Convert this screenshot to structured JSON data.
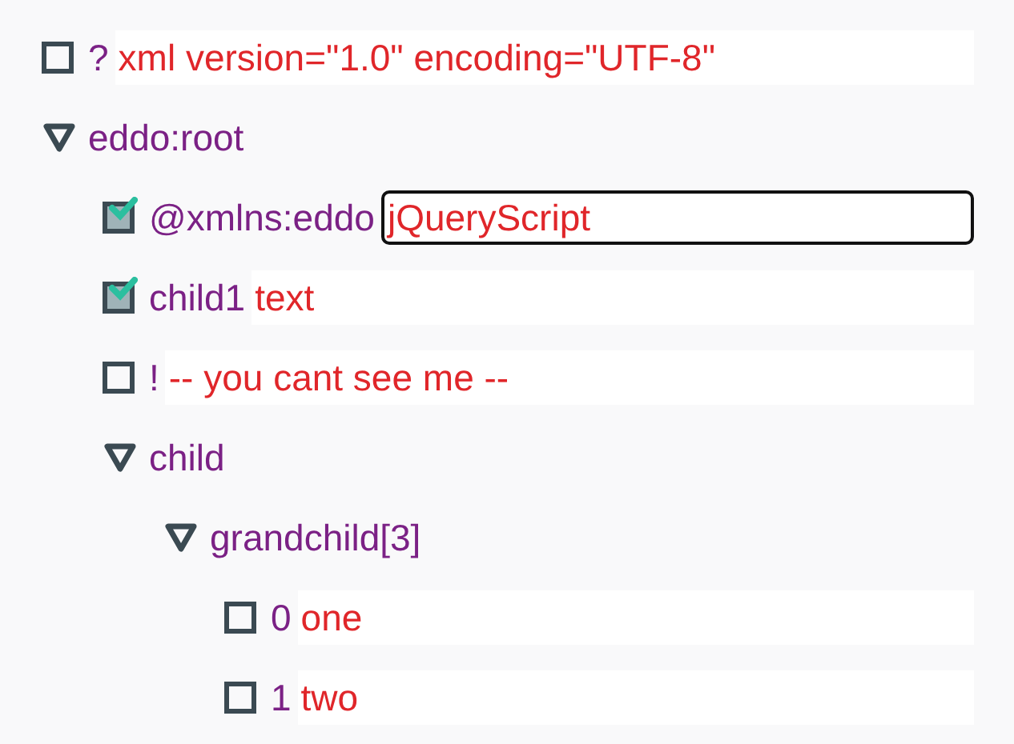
{
  "nodes": [
    {
      "kind": "leaf",
      "name": "?",
      "value": "xml version=\"1.0\" encoding=\"UTF-8\"",
      "checked": false,
      "editing": false
    },
    {
      "kind": "branch",
      "name": "eddo:root",
      "expanded": true,
      "children": [
        {
          "kind": "leaf",
          "name": "@xmlns:eddo",
          "value": "jQueryScript",
          "checked": true,
          "editing": true
        },
        {
          "kind": "leaf",
          "name": "child1",
          "value": "text",
          "checked": true,
          "editing": false
        },
        {
          "kind": "leaf",
          "name": "!",
          "value": "-- you cant see me --",
          "checked": false,
          "editing": false
        },
        {
          "kind": "branch",
          "name": "child",
          "expanded": true,
          "children": [
            {
              "kind": "branch",
              "name": "grandchild[3]",
              "expanded": true,
              "children": [
                {
                  "kind": "leaf",
                  "name": "0",
                  "value": "one",
                  "checked": false,
                  "editing": false
                },
                {
                  "kind": "leaf",
                  "name": "1",
                  "value": "two",
                  "checked": false,
                  "editing": false
                }
              ]
            }
          ]
        }
      ]
    }
  ]
}
